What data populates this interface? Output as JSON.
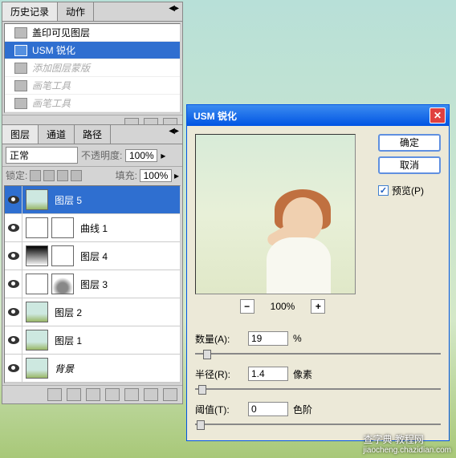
{
  "history": {
    "tabs": [
      "历史记录",
      "动作"
    ],
    "items": [
      {
        "label": "盖印可见图层",
        "state": "normal"
      },
      {
        "label": "USM 锐化",
        "state": "sel"
      },
      {
        "label": "添加图层蒙版",
        "state": "dim"
      },
      {
        "label": "画笔工具",
        "state": "dim"
      },
      {
        "label": "画笔工具",
        "state": "dim"
      }
    ]
  },
  "layers": {
    "tabs": [
      "图层",
      "通道",
      "路径"
    ],
    "blend_mode": "正常",
    "opacity_label": "不透明度:",
    "opacity_value": "100%",
    "lock_label": "锁定:",
    "fill_label": "填充:",
    "fill_value": "100%",
    "items": [
      {
        "name": "图层 5",
        "sel": true,
        "thumb": "photo"
      },
      {
        "name": "曲线 1",
        "thumb": "curves",
        "mask": "white"
      },
      {
        "name": "图层 4",
        "thumb": "grad",
        "mask": "white"
      },
      {
        "name": "图层 3",
        "thumb": "white",
        "mask": "blob"
      },
      {
        "name": "图层 2",
        "thumb": "photo"
      },
      {
        "name": "图层 1",
        "thumb": "photo"
      },
      {
        "name": "背景",
        "thumb": "photo",
        "bg": true
      }
    ]
  },
  "dialog": {
    "title": "USM 锐化",
    "ok": "确定",
    "cancel": "取消",
    "preview_label": "预览(P)",
    "preview_checked": true,
    "zoom": "100%",
    "minus": "−",
    "plus": "+",
    "params": {
      "amount_label": "数量(A):",
      "amount_value": "19",
      "amount_unit": "%",
      "radius_label": "半径(R):",
      "radius_value": "1.4",
      "radius_unit": "像素",
      "threshold_label": "阈值(T):",
      "threshold_value": "0",
      "threshold_unit": "色阶"
    }
  },
  "watermark": "查字典 教程网",
  "watermark_url": "jiaocheng.chazidian.com"
}
